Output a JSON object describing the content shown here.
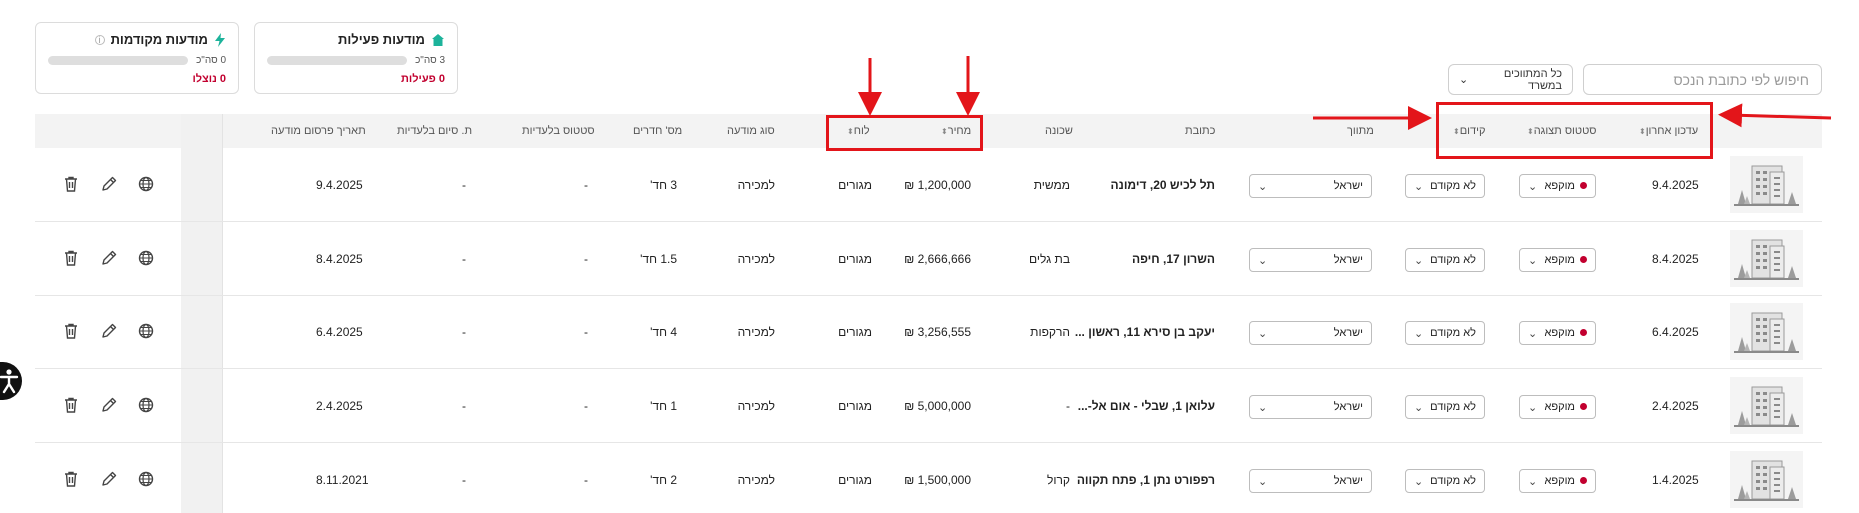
{
  "cards": [
    {
      "title": "מודעות פעילות",
      "count": "3 סה\"כ",
      "footer": "0 פעילות",
      "icon": "house-icon",
      "progress": 0
    },
    {
      "title": "מודעות מקודמות",
      "count": "0 סה\"כ",
      "footer": "0 נוצלו",
      "icon": "lightning-icon",
      "progress": 0
    }
  ],
  "search": {
    "placeholder": "חיפוש לפי כתובת הנכס"
  },
  "filter": {
    "label": "כל המתווכים במשרד"
  },
  "columns": {
    "updated": "עדכון אחרון",
    "status": "סטטוס תצוגה",
    "promotion": "קידום",
    "broker": "מתווך",
    "address": "כתובת",
    "neighborhood": "שכונה",
    "price": "מחיר",
    "board": "לוח",
    "ad_type": "סוג מודעה",
    "rooms": "מס' חדרים",
    "exclusivity_status": "סטטוס בלעדיות",
    "exclusivity_end": "ת. סיום בלעדיות",
    "published": "תאריך פרסום מודעה"
  },
  "rows": [
    {
      "updated": "9.4.2025",
      "status": "מוקפא",
      "promotion": "לא מקודם",
      "broker": "ישראל",
      "address": "תל לכיש 20, דימונה",
      "neighborhood": "ממשית",
      "price": "1,200,000 ₪",
      "board": "מגורים",
      "ad_type": "למכירה",
      "rooms": "3 חד'",
      "exclusivity_status": "-",
      "exclusivity_end": "-",
      "published": "9.4.2025"
    },
    {
      "updated": "8.4.2025",
      "status": "מוקפא",
      "promotion": "לא מקודם",
      "broker": "ישראל",
      "address": "השרון 17, חיפה",
      "neighborhood": "בת גלים",
      "price": "2,666,666 ₪",
      "board": "מגורים",
      "ad_type": "למכירה",
      "rooms": "1.5 חד'",
      "exclusivity_status": "-",
      "exclusivity_end": "-",
      "published": "8.4.2025"
    },
    {
      "updated": "6.4.2025",
      "status": "מוקפא",
      "promotion": "לא מקודם",
      "broker": "ישראל",
      "address": "יעקב בן סירא 11, ראשון ...",
      "neighborhood": "הרקפות",
      "price": "3,256,555 ₪",
      "board": "מגורים",
      "ad_type": "למכירה",
      "rooms": "4 חד'",
      "exclusivity_status": "-",
      "exclusivity_end": "-",
      "published": "6.4.2025"
    },
    {
      "updated": "2.4.2025",
      "status": "מוקפא",
      "promotion": "לא מקודם",
      "broker": "ישראל",
      "address": "עלואן 1, שבלי - אום אל-...",
      "neighborhood": "-",
      "price": "5,000,000 ₪",
      "board": "מגורים",
      "ad_type": "למכירה",
      "rooms": "1 חד'",
      "exclusivity_status": "-",
      "exclusivity_end": "-",
      "published": "2.4.2025"
    },
    {
      "updated": "1.4.2025",
      "status": "מוקפא",
      "promotion": "לא מקודם",
      "broker": "ישראל",
      "address": "רפפורט נתן 1, פתח תקווה",
      "neighborhood": "קרול",
      "price": "1,500,000 ₪",
      "board": "מגורים",
      "ad_type": "למכירה",
      "rooms": "2 חד'",
      "exclusivity_status": "-",
      "exclusivity_end": "-",
      "published": "8.11.2021"
    }
  ],
  "colors": {
    "accent_red": "#c2002f",
    "annotation_red": "#e3151a",
    "brand_green": "#1db39b"
  }
}
